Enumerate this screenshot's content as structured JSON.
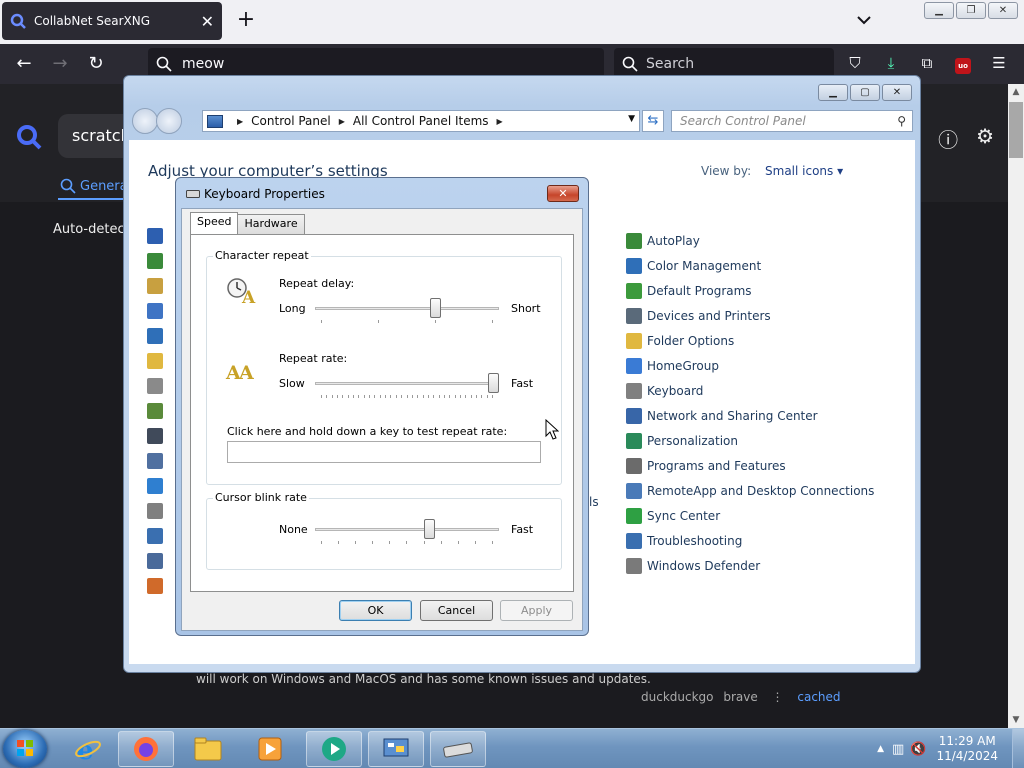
{
  "browser": {
    "tab_title": "CollabNet SearXNG",
    "tab_close": "✕",
    "new_tab": "+",
    "url_text": "meow",
    "search_placeholder": "Search"
  },
  "searx": {
    "query": "scratch",
    "tab_general": "Genera",
    "autodetect": "Auto-detect",
    "result_snippet": "will work on Windows and MacOS and has some known issues and updates.",
    "engine1": "duckduckgo",
    "engine2": "brave",
    "engine_sep": "⋮",
    "cached": "cached"
  },
  "control_panel": {
    "breadcrumb": [
      "Control Panel",
      "All Control Panel Items"
    ],
    "search_placeholder": "Search Control Panel",
    "heading": "Adjust your computer’s settings",
    "view_by_label": "View by:",
    "view_by_value": "Small icons ▾",
    "partial_text": "ls",
    "items": [
      {
        "label": "AutoPlay",
        "color": "#3a8a3a"
      },
      {
        "label": "Color Management",
        "color": "#2f6fb8"
      },
      {
        "label": "Default Programs",
        "color": "#3c9a3c"
      },
      {
        "label": "Devices and Printers",
        "color": "#5a6a7a"
      },
      {
        "label": "Folder Options",
        "color": "#e0b840"
      },
      {
        "label": "HomeGroup",
        "color": "#3a7bd5"
      },
      {
        "label": "Keyboard",
        "color": "#808080"
      },
      {
        "label": "Network and Sharing Center",
        "color": "#3866a8"
      },
      {
        "label": "Personalization",
        "color": "#2a8a5a"
      },
      {
        "label": "Programs and Features",
        "color": "#6b6b6b"
      },
      {
        "label": "RemoteApp and Desktop Connections",
        "color": "#4a7ab8"
      },
      {
        "label": "Sync Center",
        "color": "#2ea043"
      },
      {
        "label": "Troubleshooting",
        "color": "#3a6fb0"
      },
      {
        "label": "Windows Defender",
        "color": "#7a7a7a"
      }
    ],
    "left_icons": [
      "#2d5fb0",
      "#3a8a3a",
      "#c8a040",
      "#3f74c4",
      "#2f6fb8",
      "#e0b840",
      "#8a8a8a",
      "#5a8a3a",
      "#404a5a",
      "#5070a0",
      "#2f7fd0",
      "#808080",
      "#3a6fb0",
      "#4a6a9a",
      "#d06a2a"
    ]
  },
  "keyboard_dialog": {
    "title": "Keyboard Properties",
    "close": "✕",
    "tab_speed": "Speed",
    "tab_hardware": "Hardware",
    "group_char_repeat": "Character repeat",
    "repeat_delay_label": "Repeat delay:",
    "repeat_delay_min": "Long",
    "repeat_delay_max": "Short",
    "repeat_delay_value": 0.66,
    "repeat_rate_label": "Repeat rate:",
    "repeat_rate_min": "Slow",
    "repeat_rate_max": "Fast",
    "repeat_rate_value": 1.0,
    "test_label": "Click here and hold down a key to test repeat rate:",
    "test_value": "",
    "group_cursor_blink": "Cursor blink rate",
    "blink_min": "None",
    "blink_max": "Fast",
    "blink_value": 0.63,
    "ok": "OK",
    "cancel": "Cancel",
    "apply": "Apply"
  },
  "taskbar": {
    "time": "11:29 AM",
    "date": "11/4/2024"
  }
}
